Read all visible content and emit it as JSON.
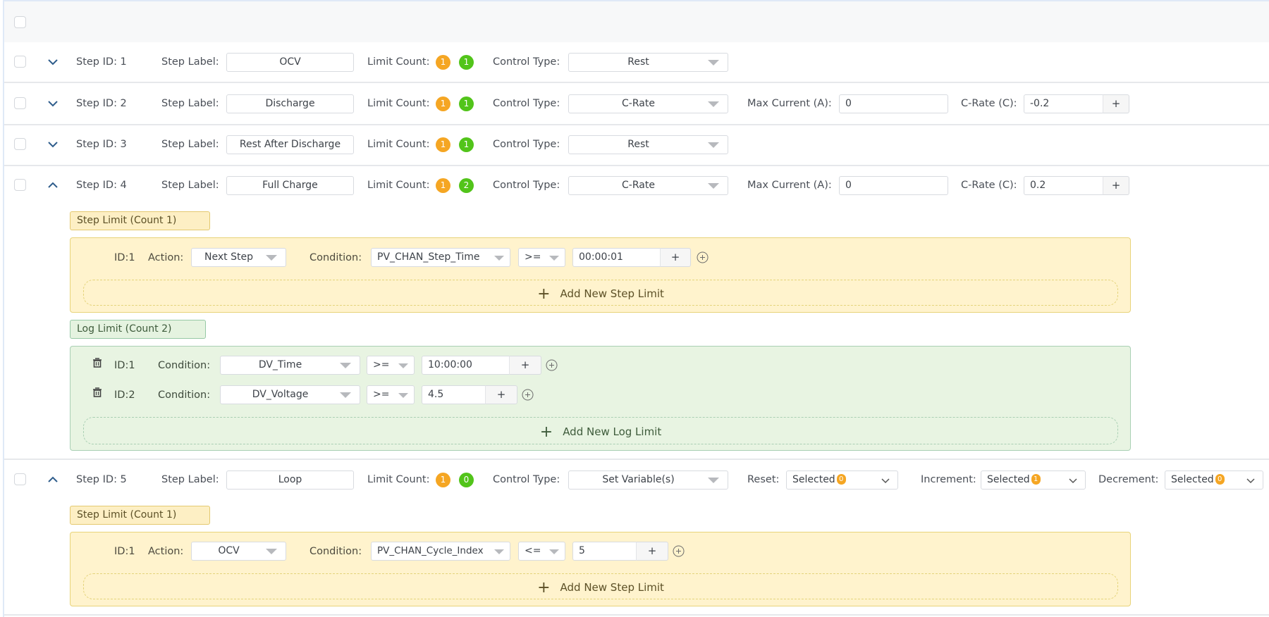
{
  "colors": {
    "limit_badge_step": "#f5a623",
    "limit_badge_log": "#52c41a",
    "step_limit_bg": "#fff3cd",
    "log_limit_bg": "#e8f4e2",
    "chevron": "#2f5d8c"
  },
  "labels": {
    "step_id_prefix": "Step ID:",
    "step_label": "Step Label:",
    "limit_count": "Limit Count:",
    "control_type": "Control Type:",
    "max_current": "Max Current (A):",
    "c_rate": "C-Rate (C):",
    "reset": "Reset:",
    "increment": "Increment:",
    "decrement": "Decrement:",
    "action": "Action:",
    "condition": "Condition:",
    "plus": "+",
    "add_step_limit": "Add New Step Limit",
    "add_log_limit": "Add New Log Limit",
    "selected": "Selected"
  },
  "steps": [
    {
      "id_text": "Step ID: 1",
      "label": "OCV",
      "step_limit_count": "1",
      "log_limit_count": "1",
      "control_type": "Rest",
      "expanded": false
    },
    {
      "id_text": "Step ID: 2",
      "label": "Discharge",
      "step_limit_count": "1",
      "log_limit_count": "1",
      "control_type": "C-Rate",
      "max_current": "0",
      "c_rate": "-0.2",
      "expanded": false
    },
    {
      "id_text": "Step ID: 3",
      "label": "Rest After Discharge",
      "step_limit_count": "1",
      "log_limit_count": "1",
      "control_type": "Rest",
      "expanded": false
    },
    {
      "id_text": "Step ID: 4",
      "label": "Full Charge",
      "step_limit_count": "1",
      "log_limit_count": "2",
      "control_type": "C-Rate",
      "max_current": "0",
      "c_rate": "0.2",
      "expanded": true,
      "step_limit_title": "Step Limit (Count 1)",
      "step_limits": [
        {
          "id": "ID:1",
          "action": "Next Step",
          "condition": "PV_CHAN_Step_Time",
          "operator": ">=",
          "value": "00:00:01"
        }
      ],
      "log_limit_title": "Log Limit (Count 2)",
      "log_limits": [
        {
          "id": "ID:1",
          "condition": "DV_Time",
          "operator": ">=",
          "value": "10:00:00"
        },
        {
          "id": "ID:2",
          "condition": "DV_Voltage",
          "operator": ">=",
          "value": "4.5"
        }
      ]
    },
    {
      "id_text": "Step ID: 5",
      "label": "Loop",
      "step_limit_count": "1",
      "log_limit_count": "0",
      "control_type": "Set Variable(s)",
      "expanded": true,
      "reset_count": "0",
      "increment_count": "1",
      "decrement_count": "0",
      "step_limit_title": "Step Limit (Count 1)",
      "step_limits": [
        {
          "id": "ID:1",
          "action": "OCV",
          "condition": "PV_CHAN_Cycle_Index",
          "operator": "<=",
          "value": "5"
        }
      ]
    }
  ]
}
